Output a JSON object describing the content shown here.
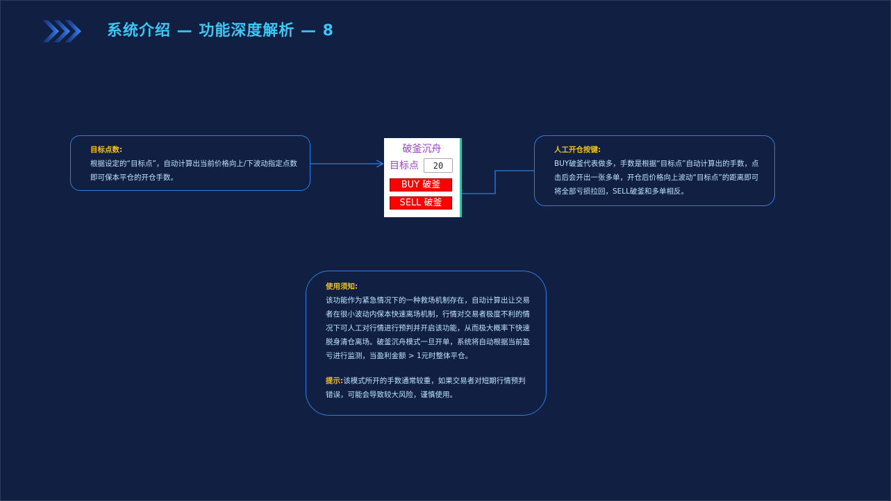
{
  "title": {
    "text": "系统介绍 — 功能深度解析 — 8"
  },
  "panel": {
    "title": "破釜沉舟",
    "target_label": "目标点",
    "target_value": "20",
    "buy_label": "BUY 破釜",
    "sell_label": "SELL 破釜"
  },
  "callouts": {
    "target_points": {
      "heading": "目标点数:",
      "body": "根据设定的“目标点”，自动计算出当前价格向上/下波动指定点数即可保本平仓的开仓手数。"
    },
    "manual_buttons": {
      "heading": "人工开仓按键:",
      "body": "BUY破釜代表做多，手数是根据“目标点”自动计算出的手数，点击后会开出一张多单，开仓后价格向上波动“目标点”的距离即可将全部亏损拉回，SELL破釜和多单相反。"
    },
    "usage_notes": {
      "heading": "使用须知:",
      "body": "该功能作为紧急情况下的一种救场机制存在，自动计算出让交易者在很小波动内保本快速离场机制，行情对交易者极度不利的情况下可人工对行情进行预判并开启该功能，从而极大概率下快速脱身清仓离场。破釜沉舟模式一旦开单，系统将自动根据当前盈亏进行监测，当盈利金额 > 1元时整体平仓。",
      "tip_heading": "提示:",
      "tip_body": "该模式所开的手数通常较重，如果交易者对短期行情预判错误，可能会导致较大风险，谨慎使用。"
    }
  },
  "colors": {
    "background": "#101f42",
    "title": "#3cc7f5",
    "callout_border": "#2f7fe0",
    "callout_text": "#bfe4ff",
    "heading": "#f2c01c",
    "panel_text": "#9b3fc8",
    "button": "#ff0000"
  },
  "icons": {
    "title_decoration": "triple-chevron-right-icon"
  }
}
